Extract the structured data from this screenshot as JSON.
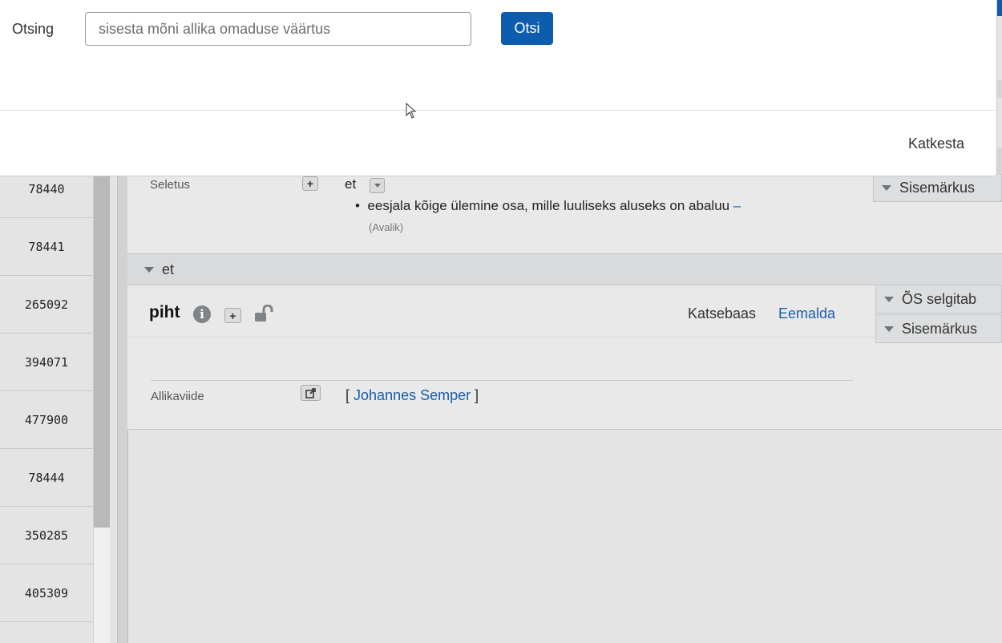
{
  "search_dialog": {
    "label": "Otsing",
    "placeholder": "sisesta mõni allika omaduse väärtus",
    "search_button": "Otsi",
    "cancel_button": "Katkesta"
  },
  "id_list": [
    "78440",
    "78441",
    "265092",
    "394071",
    "477900",
    "78444",
    "350285",
    "405309"
  ],
  "definition": {
    "label": "Seletus",
    "lang": "et",
    "text": "eesjala kõige ülemine osa, mille luuliseks aluseks on abaluu",
    "dash": "–",
    "visibility": "(Avalik)",
    "side_tag": "Sisemärkus"
  },
  "lang_section": {
    "label": "et"
  },
  "word_entry": {
    "word": "piht",
    "dataset": "Katsebaas",
    "remove_link": "Eemalda",
    "side_tags": [
      "ÕS selgitab",
      "Sisemärkus"
    ],
    "source_label": "Allikaviide",
    "source_open": "[",
    "source_link": "Johannes Semper",
    "source_close": "]"
  }
}
